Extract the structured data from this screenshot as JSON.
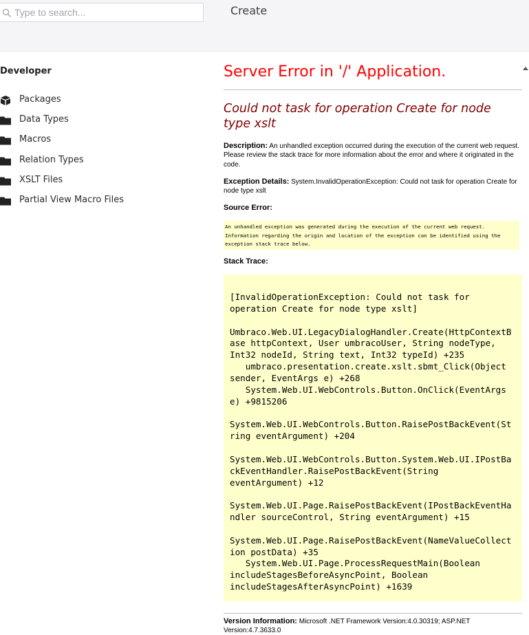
{
  "search": {
    "placeholder": "Type to search..."
  },
  "header": {
    "title": "Create"
  },
  "sidebar": {
    "section_title": "Developer",
    "items": [
      {
        "label": "Packages",
        "icon": "package-icon"
      },
      {
        "label": "Data Types",
        "icon": "folder-icon"
      },
      {
        "label": "Macros",
        "icon": "folder-icon"
      },
      {
        "label": "Relation Types",
        "icon": "folder-icon"
      },
      {
        "label": "XSLT Files",
        "icon": "folder-icon"
      },
      {
        "label": "Partial View Macro Files",
        "icon": "folder-icon"
      }
    ]
  },
  "error": {
    "title": "Server Error in '/' Application.",
    "subtitle": "Could not task for operation Create for node type xslt",
    "description_label": "Description:",
    "description_text": "An unhandled exception occurred during the execution of the current web request. Please review the stack trace for more information about the error and where it originated in the code.",
    "exception_label": "Exception Details:",
    "exception_text": "System.InvalidOperationException: Could not task for operation Create for node type xslt",
    "source_error_label": "Source Error:",
    "source_error_text": "An unhandled exception was generated during the execution of the current web request.\nInformation regarding the origin and location of the exception can be identified using the\nexception stack trace below.",
    "stack_trace_label": "Stack Trace:",
    "stack_trace_text": "[InvalidOperationException: Could not task for\noperation Create for node type xslt]\n\nUmbraco.Web.UI.LegacyDialogHandler.Create(HttpContextB\nase httpContext, User umbracoUser, String nodeType,\nInt32 nodeId, String text, Int32 typeId) +235\n   umbraco.presentation.create.xslt.sbmt_Click(Object\nsender, EventArgs e) +268\n   System.Web.UI.WebControls.Button.OnClick(EventArgs\ne) +9815206\n\nSystem.Web.UI.WebControls.Button.RaisePostBackEvent(St\nring eventArgument) +204\n\nSystem.Web.UI.WebControls.Button.System.Web.UI.IPostBa\nckEventHandler.RaisePostBackEvent(String\neventArgument) +12\n\nSystem.Web.UI.Page.RaisePostBackEvent(IPostBackEventHa\nndler sourceControl, String eventArgument) +15\n\nSystem.Web.UI.Page.RaisePostBackEvent(NameValueCollect\nion postData) +35\n   System.Web.UI.Page.ProcessRequestMain(Boolean\nincludeStagesBeforeAsyncPoint, Boolean\nincludeStagesAfterAsyncPoint) +1639",
    "version_label": "Version Information:",
    "version_text": "Microsoft .NET Framework Version:4.0.30319; ASP.NET Version:4.7.3633.0"
  },
  "colors": {
    "error_title": "#ff0000",
    "error_subtitle": "#800000",
    "code_background": "#ffffcc",
    "topbar_background": "#f5f5f7"
  }
}
